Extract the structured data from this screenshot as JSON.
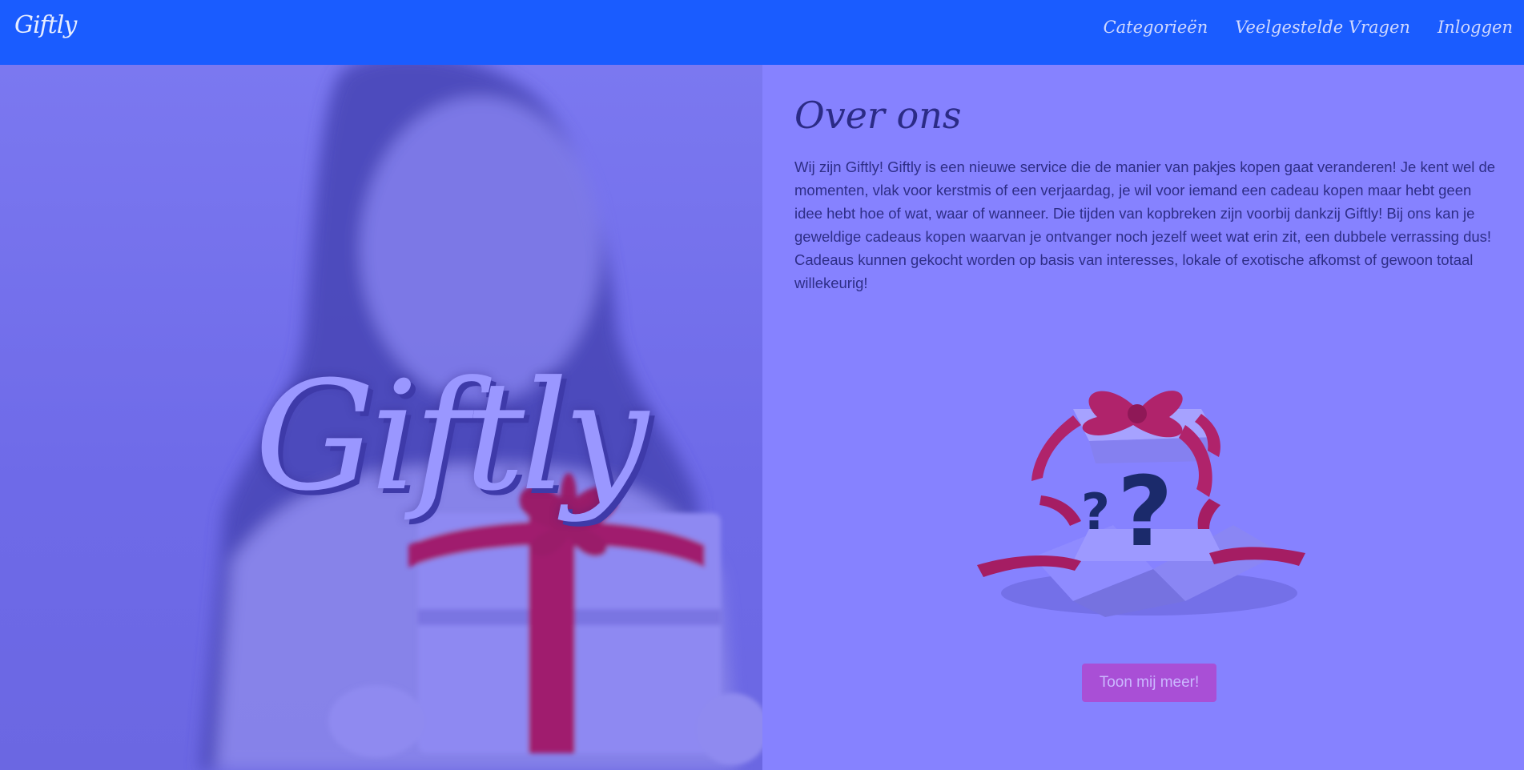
{
  "navbar": {
    "brand": "Giftly",
    "links": [
      "Categorieën",
      "Veelgestelde Vragen",
      "Inloggen"
    ]
  },
  "hero": {
    "title": "Giftly"
  },
  "about": {
    "heading": "Over ons",
    "text": "Wij zijn Giftly! Giftly is een nieuwe service die de manier van pakjes kopen gaat veranderen! Je kent wel de momenten, vlak voor kerstmis of een verjaardag, je wil voor iemand een cadeau kopen maar hebt geen idee hebt hoe of wat, waar of wanneer. Die tijden van kopbreken zijn voorbij dankzij Giftly! Bij ons kan je geweldige cadeaus kopen waarvan je ontvanger noch jezelf weet wat erin zit, een dubbele verrassing dus! Cadeaus kunnen gekocht worden op basis van interesses, lokale of exotische afkomst of gewoon totaal willekeurig!",
    "button_label": "Toon mij meer!"
  },
  "colors": {
    "navbar": "#1a5cff",
    "page_bg": "#8682ff",
    "heading": "#2b2b86",
    "button": "#a94fd6",
    "ribbon": "#b0236b"
  }
}
